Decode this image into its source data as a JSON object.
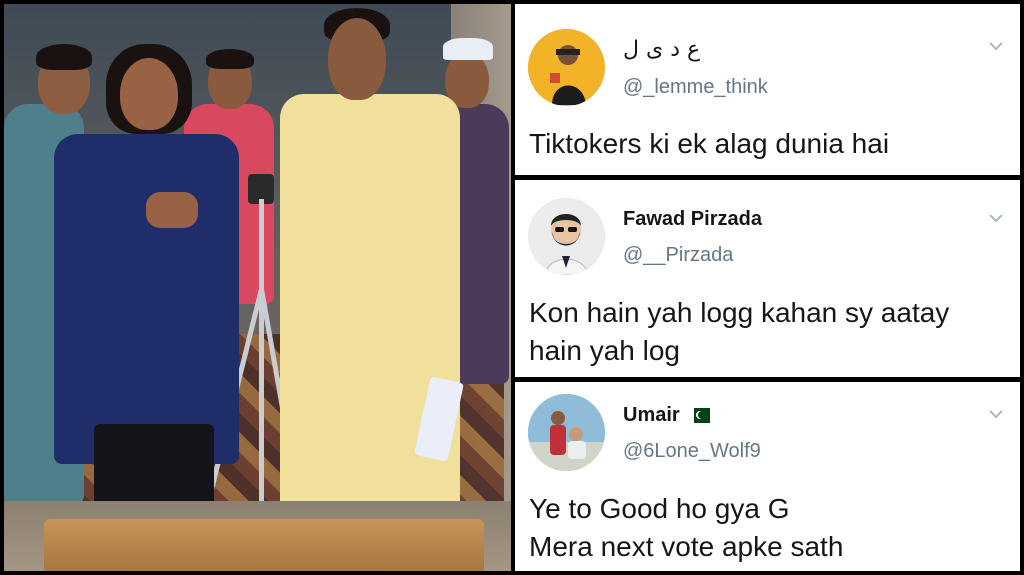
{
  "tweets": [
    {
      "display_name": "ع د ی ل",
      "handle": "@_lemme_think",
      "text": "Tiktokers ki ek alag dunia hai",
      "avatar_icon": "man-with-cap-avatar",
      "avatar_bg": "#f2b328"
    },
    {
      "display_name": "Fawad Pirzada",
      "handle": "@__Pirzada",
      "text_line1": "Kon hain yah logg kahan sy aatay",
      "text_line2": "hain yah log",
      "avatar_icon": "bearded-man-sunglasses-avatar",
      "avatar_bg": "#e6e6e6"
    },
    {
      "display_name": "Umair",
      "flag_icon": "pakistan-flag-icon",
      "handle": "@6Lone_Wolf9",
      "text_line1": "Ye to Good ho gya G",
      "text_line2": "Mera next vote apke sath",
      "avatar_icon": "kids-photo-avatar",
      "avatar_bg": "#7ab6d6"
    }
  ],
  "colors": {
    "name": "#14171a",
    "handle": "#657786",
    "chevron": "#aab8c2"
  }
}
